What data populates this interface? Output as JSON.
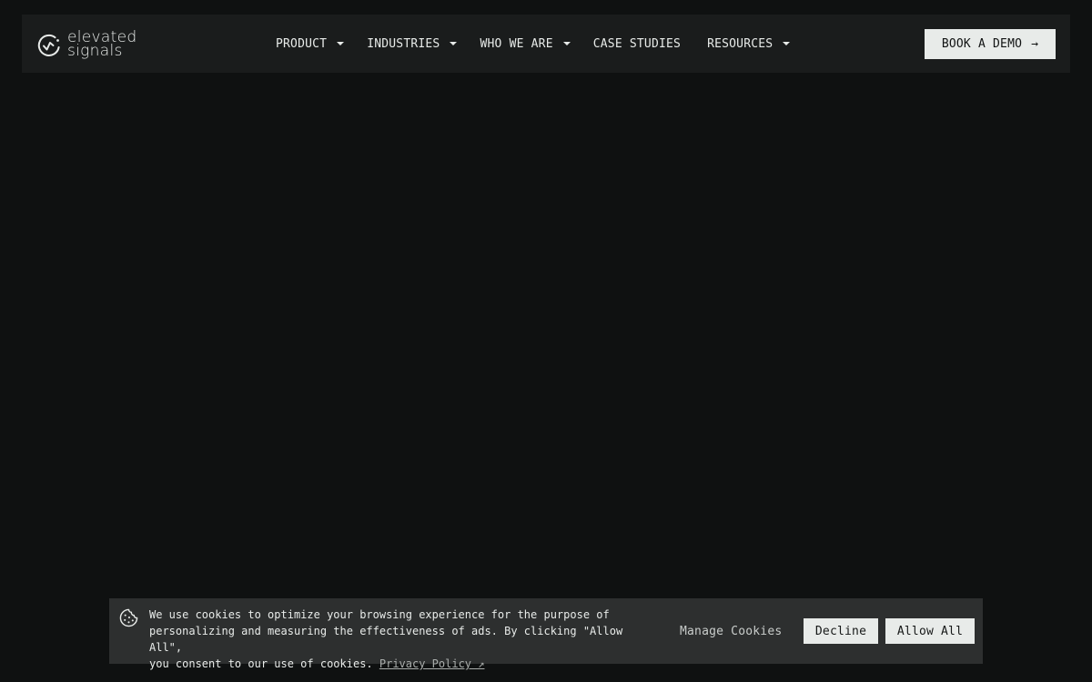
{
  "brand": {
    "line1": "elevated",
    "line2": "signals",
    "icon": "elevated-signals-logo-icon"
  },
  "nav": {
    "product": "PRODUCT",
    "industries": "INDUSTRIES",
    "who_we_are": "WHO WE ARE",
    "case_studies": "CASE STUDIES",
    "resources": "RESOURCES",
    "dropdown_icon": "caret-down-icon"
  },
  "cta": {
    "label": "BOOK A DEMO",
    "arrow": "→"
  },
  "cookie_banner": {
    "icon": "cookie-icon",
    "line1": "We use cookies to optimize your browsing experience for the purpose of",
    "line2": "personalizing and measuring the effectiveness of ads. By clicking \"Allow All\",",
    "line3": "you consent to our use of cookies.",
    "privacy_link": "Privacy Policy ↗",
    "manage_label": "Manage Cookies",
    "decline_label": "Decline",
    "allow_label": "Allow All"
  },
  "colors": {
    "page_background": "#0f1111",
    "topbar_background": "#1a1c1c",
    "banner_background": "#2d2f2f",
    "button_background": "#e8ebe9",
    "text": "#e8ebe9"
  }
}
